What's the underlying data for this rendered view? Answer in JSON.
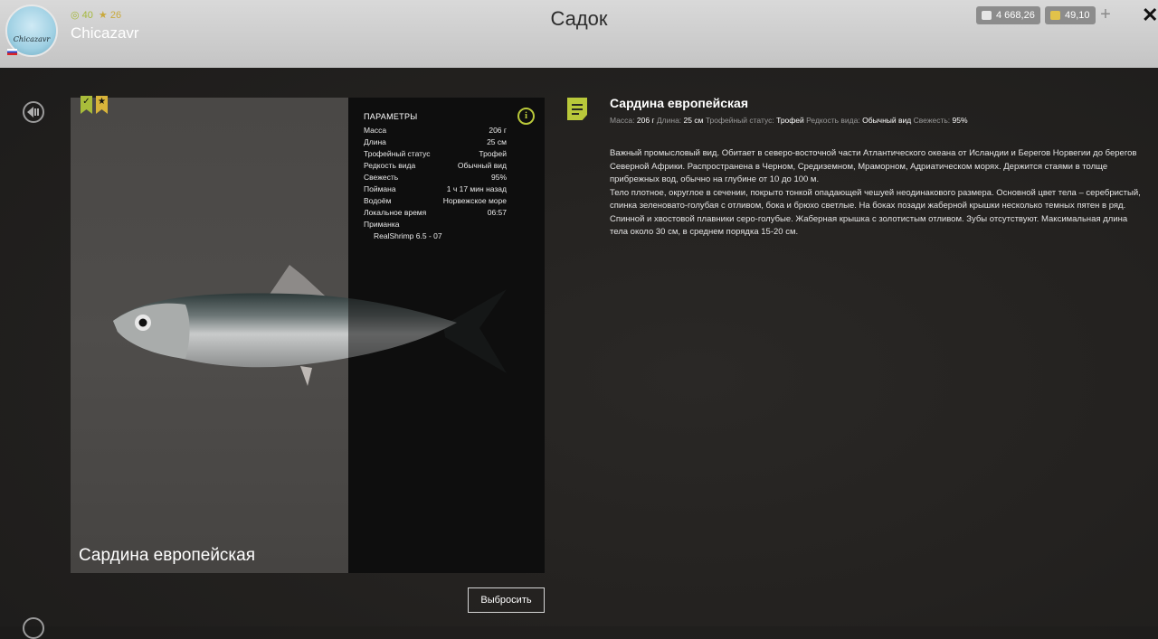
{
  "player": {
    "avatar_text": "Chicazavr",
    "name": "Chicazavr",
    "stat_green": "40",
    "stat_yellow": "26"
  },
  "page_title": "Садок",
  "currency": {
    "silver": "4 668,26",
    "gold": "49,10",
    "plus": "+"
  },
  "card": {
    "fish_name": "Сардина европейская",
    "params_title": "ПАРАМЕТРЫ",
    "params": [
      {
        "label": "Масса",
        "value": "206 г"
      },
      {
        "label": "Длина",
        "value": "25 см"
      },
      {
        "label": "Трофейный статус",
        "value": "Трофей"
      },
      {
        "label": "Редкость вида",
        "value": "Обычный вид"
      },
      {
        "label": "Свежесть",
        "value": "95%"
      },
      {
        "label": "Поймана",
        "value": "1 ч 17 мин назад"
      },
      {
        "label": "Водоём",
        "value": "Норвежское море"
      },
      {
        "label": "Локальное время",
        "value": "06:57"
      }
    ],
    "bait_label": "Приманка",
    "bait_value": "RealShrimp 6.5 - 07",
    "discard_label": "Выбросить"
  },
  "description": {
    "title": "Сардина европейская",
    "meta": [
      {
        "label": "Масса:",
        "value": "206 г"
      },
      {
        "label": "Длина:",
        "value": "25 см"
      },
      {
        "label": "Трофейный статус:",
        "value": "Трофей"
      },
      {
        "label": "Редкость вида:",
        "value": "Обычный вид"
      },
      {
        "label": "Свежесть:",
        "value": "95%"
      }
    ],
    "text": "Важный промысловый вид. Обитает в северо-восточной части Атлантического океана от Исландии и Берегов Норвегии до берегов Северной Африки. Распространена в Черном, Средиземном, Мраморном, Адриатическом морях. Держится стаями в толще прибрежных вод, обычно на глубине от 10 до 100 м.\nТело плотное, округлое в сечении, покрыто тонкой опадающей чешуей неодинакового размера. Основной цвет тела – серебристый, спинка зеленовато-голубая с отливом, бока и брюхо светлые. На боках позади жаберной крышки несколько темных пятен в ряд. Спинной и хвостовой плавники серо-голубые. Жаберная крышка с золотистым отливом. Зубы отсутствуют. Максимальная длина тела около 30 см, в среднем порядка 15-20 см."
  },
  "colors": {
    "accent": "#b9c83a",
    "topbar": "#cfcfcf",
    "panel_dark": "#0e0e0e"
  }
}
